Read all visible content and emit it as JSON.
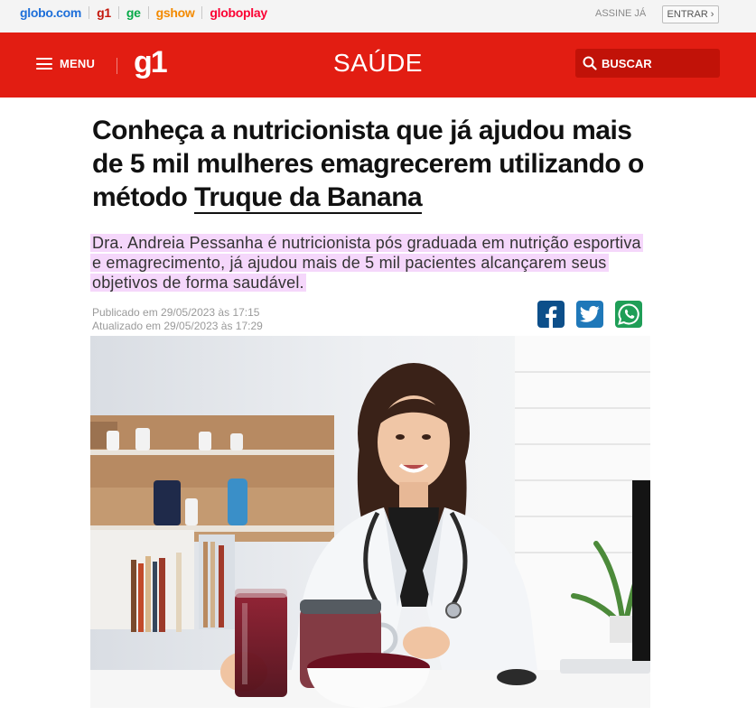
{
  "topbar": {
    "brands": [
      {
        "label": "globo.com",
        "color": "#1e6fd9"
      },
      {
        "label": "g1",
        "color": "#c4170c"
      },
      {
        "label": "ge",
        "color": "#06aa48"
      },
      {
        "label": "gshow",
        "color": "#f38a00"
      },
      {
        "label": "globoplay",
        "color": "#fb0234"
      }
    ],
    "assine_label": "ASSINE JÁ",
    "entrar_label": "ENTRAR"
  },
  "header": {
    "background": "#e21d12",
    "menu_label": "MENU",
    "logo": "g1",
    "section": "SAÚDE",
    "search_label": "BUSCAR"
  },
  "article": {
    "title_text": "Conheça a nutricionista que já ajudou mais de 5 mil mulheres emagrecerem utilizando o método",
    "title_link": "Truque da Banana",
    "subtitle": "Dra. Andreia Pessanha é nutricionista pós graduada em nutrição esportiva e emagrecimento, já ajudou mais de 5 mil pacientes alcançarem seus objetivos de forma saudável.",
    "published": "Publicado em 29/05/2023 às 17:15",
    "updated": "Atualizado em 29/05/2023 às 17:29"
  },
  "share": {
    "facebook_color": "#0d4f8a",
    "twitter_color": "#1f78b9",
    "whatsapp_color": "#1f9e57"
  }
}
